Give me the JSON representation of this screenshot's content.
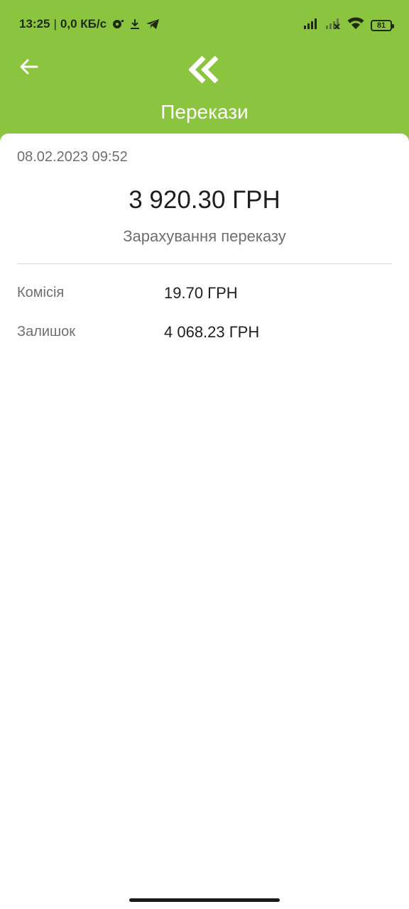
{
  "status_bar": {
    "time": "13:25",
    "separator": "|",
    "network_speed": "0,0 КБ/с",
    "battery_level": "81",
    "icons": [
      "media-icon",
      "download-icon",
      "telegram-icon",
      "signal-icon",
      "signal-no-service-icon",
      "wifi-icon",
      "battery-icon"
    ]
  },
  "header": {
    "title": "Перекази",
    "back_icon": "arrow-left-icon",
    "logo_icon": "double-chevron-logo-icon",
    "background_color": "#8bc53f"
  },
  "transaction": {
    "datetime": "08.02.2023 09:52",
    "amount": "3 920.30 ГРН",
    "description": "Зарахування переказу",
    "details": [
      {
        "label": "Комісія",
        "value": "19.70 ГРН"
      },
      {
        "label": "Залишок",
        "value": "4 068.23 ГРН"
      }
    ]
  }
}
